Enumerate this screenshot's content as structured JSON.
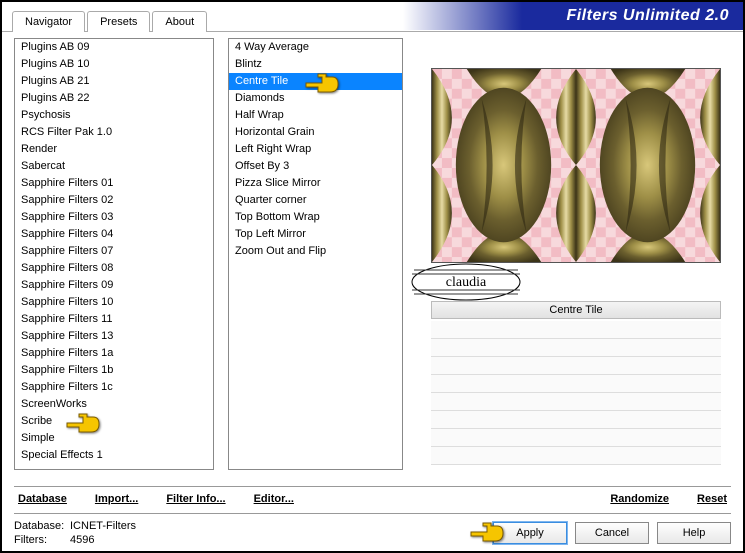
{
  "app_title": "Filters Unlimited 2.0",
  "tabs": [
    "Navigator",
    "Presets",
    "About"
  ],
  "active_tab": 0,
  "category_list": [
    "Plugins AB 09",
    "Plugins AB 10",
    "Plugins AB 21",
    "Plugins AB 22",
    "Psychosis",
    "RCS Filter Pak 1.0",
    "Render",
    "Sabercat",
    "Sapphire Filters 01",
    "Sapphire Filters 02",
    "Sapphire Filters 03",
    "Sapphire Filters 04",
    "Sapphire Filters 07",
    "Sapphire Filters 08",
    "Sapphire Filters 09",
    "Sapphire Filters 10",
    "Sapphire Filters 11",
    "Sapphire Filters 13",
    "Sapphire Filters 1a",
    "Sapphire Filters 1b",
    "Sapphire Filters 1c",
    "ScreenWorks",
    "Scribe",
    "Simple",
    "Special Effects 1"
  ],
  "category_selected_index": 23,
  "filter_list": [
    "4 Way Average",
    "Blintz",
    "Centre Tile",
    "Diamonds",
    "Half Wrap",
    "Horizontal Grain",
    "Left Right Wrap",
    "Offset By 3",
    "Pizza Slice Mirror",
    "Quarter corner",
    "Top Bottom Wrap",
    "Top Left Mirror",
    "Zoom Out and Flip"
  ],
  "filter_selected_index": 2,
  "param_header": "Centre Tile",
  "bottom_actions": {
    "database": "Database",
    "import": "Import...",
    "filter_info": "Filter Info...",
    "editor": "Editor...",
    "randomize": "Randomize",
    "reset": "Reset"
  },
  "status": {
    "db_label": "Database:",
    "db_value": "ICNET-Filters",
    "filters_label": "Filters:",
    "filters_value": "4596"
  },
  "buttons": {
    "apply": "Apply",
    "cancel": "Cancel",
    "help": "Help"
  },
  "watermark": "claudia"
}
